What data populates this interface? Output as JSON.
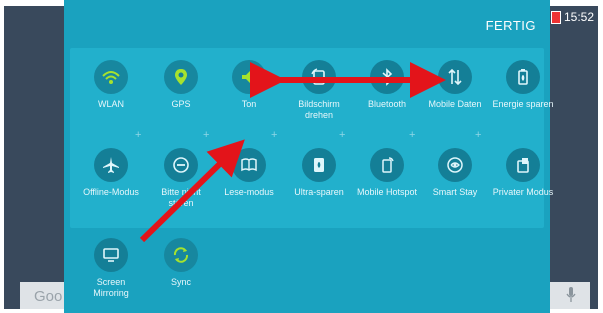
{
  "status": {
    "time": "15:52",
    "percent_glyph": "%"
  },
  "search": {
    "placeholder": "Goo"
  },
  "panel": {
    "done_label": "FERTIG"
  },
  "tiles": [
    {
      "label": "WLAN",
      "icon": "wifi-icon",
      "active": true
    },
    {
      "label": "GPS",
      "icon": "location-icon",
      "active": true
    },
    {
      "label": "Ton",
      "icon": "volume-icon",
      "active": true
    },
    {
      "label": "Bildschirm drehen",
      "icon": "rotate-icon",
      "active": false
    },
    {
      "label": "Bluetooth",
      "icon": "bluetooth-icon",
      "active": false
    },
    {
      "label": "Mobile Daten",
      "icon": "mobile-data-icon",
      "active": false
    },
    {
      "label": "Energie sparen",
      "icon": "battery-saver-icon",
      "active": false
    },
    {
      "label": "Offline-Modus",
      "icon": "airplane-icon",
      "active": false
    },
    {
      "label": "Bitte nicht stören",
      "icon": "do-not-disturb-icon",
      "active": false
    },
    {
      "label": "Lese-modus",
      "icon": "book-icon",
      "active": false
    },
    {
      "label": "Ultra-sparen",
      "icon": "ultra-saver-icon",
      "active": false
    },
    {
      "label": "Mobile Hotspot",
      "icon": "hotspot-icon",
      "active": false
    },
    {
      "label": "Smart Stay",
      "icon": "smart-stay-icon",
      "active": false
    },
    {
      "label": "Privater Modus",
      "icon": "private-mode-icon",
      "active": false
    },
    {
      "label": "Screen Mirroring",
      "icon": "screen-mirroring-icon",
      "active": false
    },
    {
      "label": "Sync",
      "icon": "sync-icon",
      "active": true
    }
  ],
  "colors": {
    "panel": "#1aa2bf",
    "tile_circle": "#147f97",
    "active_icon": "#a6e22e",
    "arrow": "#e3141a"
  }
}
